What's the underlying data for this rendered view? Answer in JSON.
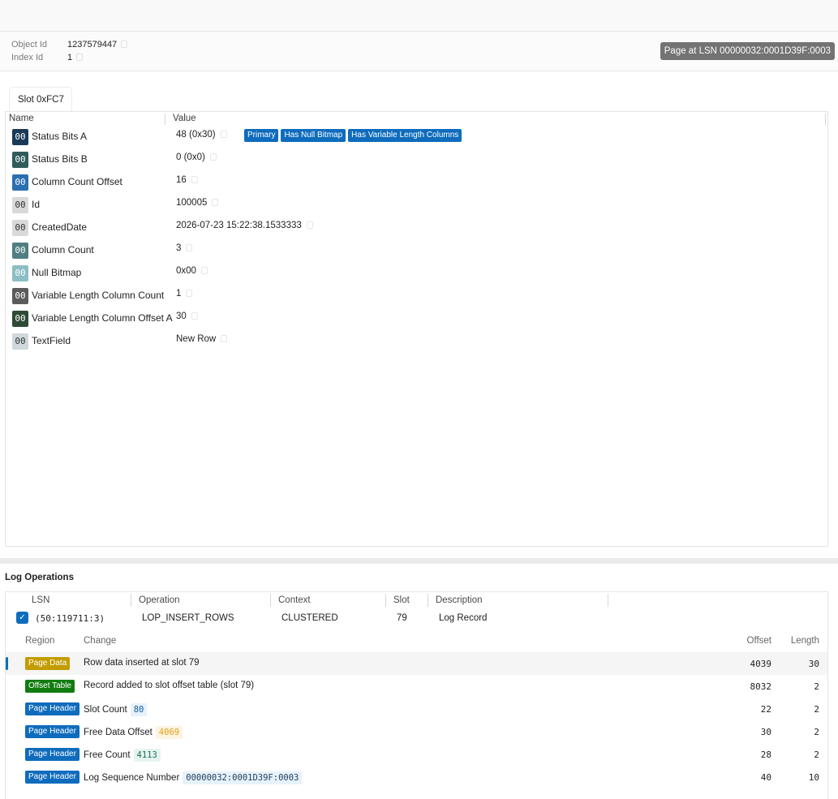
{
  "meta": {
    "object_id_label": "Object Id",
    "object_id": "1237579447",
    "index_id_label": "Index Id",
    "index_id": "1",
    "page_lsn_badge": "Page at LSN 00000032:0001D39F:0003"
  },
  "tab": {
    "label": "Slot 0xFC7"
  },
  "fields": {
    "col_name": "Name",
    "col_value": "Value",
    "chip_glyph": "00",
    "rows": [
      {
        "name": "Status Bits A",
        "value": "48 (0x30)",
        "color": "#1b3a57",
        "tags": [
          "Primary",
          "Has Null Bitmap",
          "Has Variable Length Columns"
        ]
      },
      {
        "name": "Status Bits B",
        "value": "0 (0x0)",
        "color": "#2f5d5a"
      },
      {
        "name": "Column Count Offset",
        "value": "16",
        "color": "#2a6fb0"
      },
      {
        "name": "Id",
        "value": "100005",
        "color": "#d9d9d9",
        "dark": true
      },
      {
        "name": "CreatedDate",
        "value": "2026-07-23 15:22:38.1533333",
        "color": "#d9d9d9",
        "dark": true
      },
      {
        "name": "Column Count",
        "value": "3",
        "color": "#4f7f82"
      },
      {
        "name": "Null Bitmap",
        "value": "0x00",
        "color": "#8bbfc4"
      },
      {
        "name": "Variable Length Column Count",
        "value": "1",
        "color": "#5c5c5c"
      },
      {
        "name": "Variable Length Column Offset A",
        "value": "30",
        "color": "#2f4b36"
      },
      {
        "name": "TextField",
        "value": "New Row",
        "color": "#cfd8dc",
        "dark": true
      }
    ]
  },
  "log": {
    "title": "Log Operations",
    "columns": {
      "lsn": "LSN",
      "operation": "Operation",
      "context": "Context",
      "slot": "Slot",
      "description": "Description"
    },
    "operation": {
      "checked": "✓",
      "lsn": "(50:119711:3)",
      "operation": "LOP_INSERT_ROWS",
      "context": "CLUSTERED",
      "slot": "79",
      "description": "Log Record"
    },
    "region_columns": {
      "region": "Region",
      "change": "Change",
      "offset": "Offset",
      "length": "Length"
    },
    "regions": [
      {
        "badge": "Page Data",
        "badge_color": "#c29c00",
        "change": "Row data inserted at slot 79",
        "offset": "4039",
        "length": "30",
        "selected": true
      },
      {
        "badge": "Offset Table",
        "badge_color": "#107c10",
        "change": "Record added to slot offset table (slot 79)",
        "offset": "8032",
        "length": "2"
      },
      {
        "badge": "Page Header",
        "badge_color": "#0f6cbd",
        "change": "Slot Count",
        "chip": "80",
        "chip_bg": "#e6f2fb",
        "chip_fg": "#0f5a9e",
        "offset": "22",
        "length": "2"
      },
      {
        "badge": "Page Header",
        "badge_color": "#0f6cbd",
        "change": "Free Data Offset",
        "chip": "4069",
        "chip_bg": "#fdf3e1",
        "chip_fg": "#e3a21a",
        "offset": "30",
        "length": "2"
      },
      {
        "badge": "Page Header",
        "badge_color": "#0f6cbd",
        "change": "Free Count",
        "chip": "4113",
        "chip_bg": "#e6f4ef",
        "chip_fg": "#17715a",
        "offset": "28",
        "length": "2"
      },
      {
        "badge": "Page Header",
        "badge_color": "#0f6cbd",
        "change": "Log Sequence Number",
        "chip": "00000032:0001D39F:0003",
        "chip_bg": "#e6f2fb",
        "chip_fg": "#1f3b57",
        "offset": "40",
        "length": "10"
      }
    ]
  }
}
